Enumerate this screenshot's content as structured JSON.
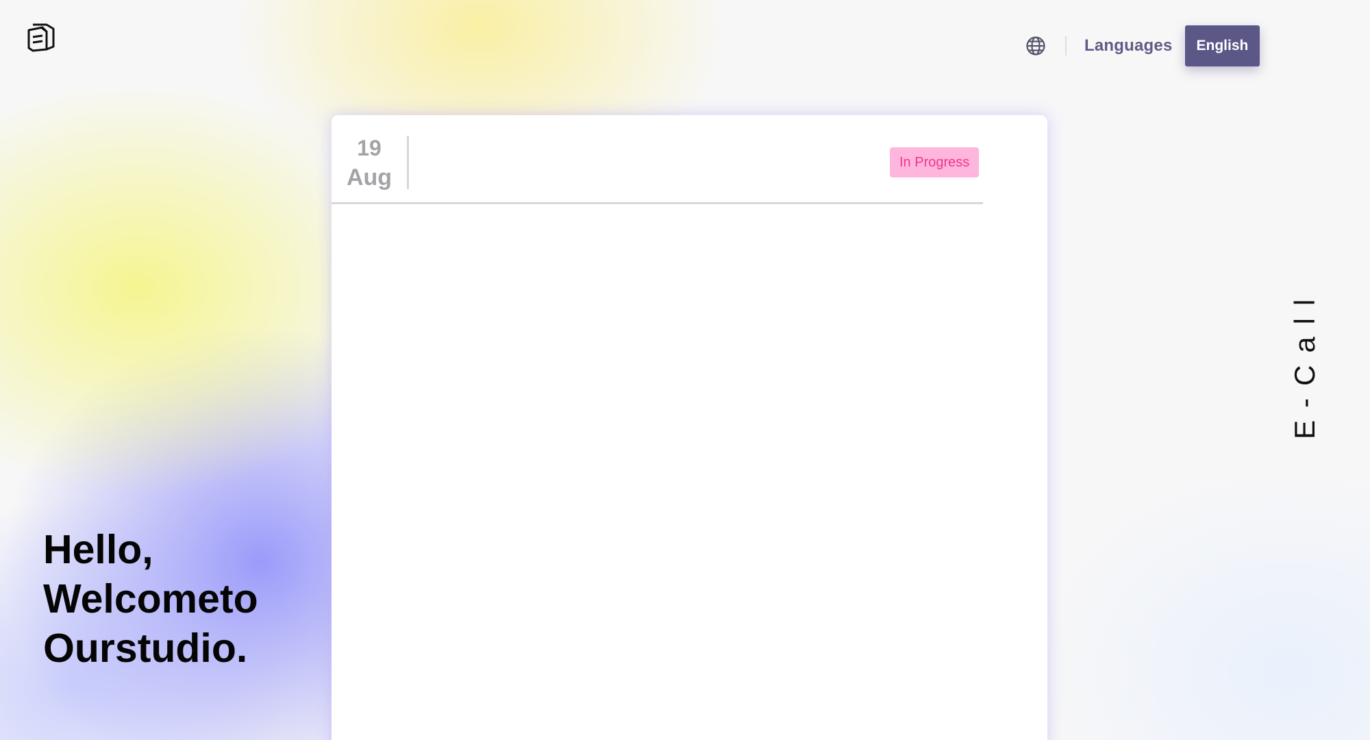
{
  "header": {
    "logo_icon": "stacked-box-logo-icon",
    "globe_icon": "globe-icon",
    "languages_label": "Languages",
    "language_button": "English",
    "accent_color": "#5b5787"
  },
  "card": {
    "date_day": "19",
    "date_month": "Aug",
    "status": "In Progress",
    "status_bg_color": "#ffb6dc",
    "status_text_color": "#f0358f"
  },
  "hero": {
    "line1": "Hello,",
    "line2": "Welcometo",
    "line3": "Ourstudio."
  },
  "brand_vertical": "E-Call"
}
